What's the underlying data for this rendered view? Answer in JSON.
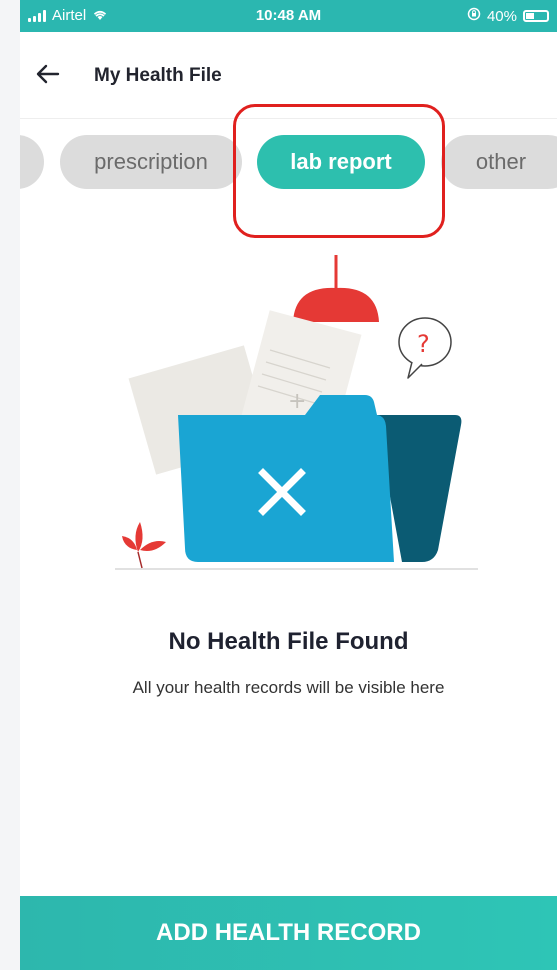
{
  "status_bar": {
    "carrier": "Airtel",
    "time": "10:48 AM",
    "battery": "40%",
    "battery_level": 0.4
  },
  "header": {
    "title": "My Health File",
    "back_icon": "arrow-left-icon"
  },
  "tabs": [
    {
      "label": "prescription",
      "active": false
    },
    {
      "label": "lab report",
      "active": true
    },
    {
      "label": "other",
      "active": false
    }
  ],
  "empty_state": {
    "title": "No Health File Found",
    "subtitle": "All your health records will be visible here"
  },
  "cta": {
    "label": "ADD HEALTH RECORD"
  },
  "colors": {
    "accent": "#2dbfae",
    "highlight": "#e0201e",
    "chip_inactive": "#dcdcdc",
    "folder": "#1aa5d3",
    "folder_dark": "#0b5b73",
    "lamp": "#e53935"
  }
}
